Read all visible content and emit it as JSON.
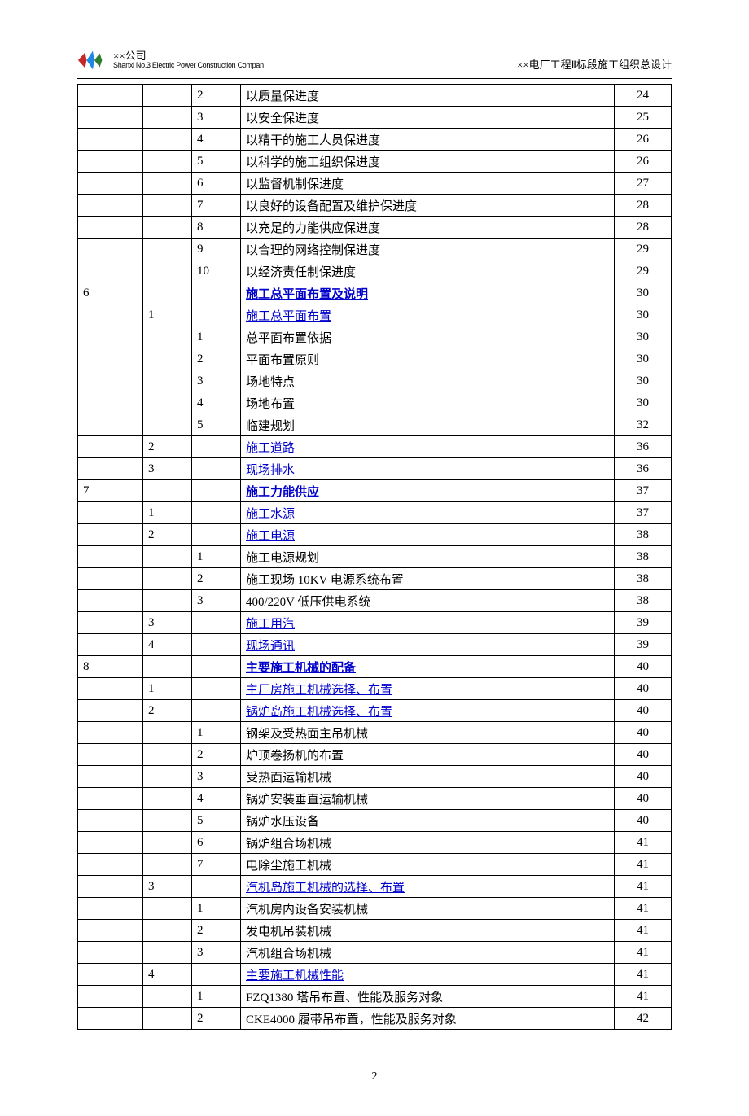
{
  "header": {
    "company_cn": "××公司",
    "company_en": "Shanxi No.3 Electric Power Construction Compan",
    "doc_title": "××电厂工程Ⅱ标段施工组织总设计"
  },
  "rows": [
    {
      "c1": "",
      "c2": "",
      "c3": "2",
      "title": "以质量保进度",
      "type": "plain",
      "page": "24"
    },
    {
      "c1": "",
      "c2": "",
      "c3": "3",
      "title": "以安全保进度",
      "type": "plain",
      "page": "25"
    },
    {
      "c1": "",
      "c2": "",
      "c3": "4",
      "title": "以精干的施工人员保进度",
      "type": "plain",
      "page": "26"
    },
    {
      "c1": "",
      "c2": "",
      "c3": "5",
      "title": "以科学的施工组织保进度",
      "type": "plain",
      "page": "26"
    },
    {
      "c1": "",
      "c2": "",
      "c3": "6",
      "title": "以监督机制保进度",
      "type": "plain",
      "page": "27"
    },
    {
      "c1": "",
      "c2": "",
      "c3": "7",
      "title": "以良好的设备配置及维护保进度",
      "type": "plain",
      "page": "28"
    },
    {
      "c1": "",
      "c2": "",
      "c3": "8",
      "title": "以充足的力能供应保进度",
      "type": "plain",
      "page": "28"
    },
    {
      "c1": "",
      "c2": "",
      "c3": "9",
      "title": "以合理的网络控制保进度",
      "type": "plain",
      "page": "29"
    },
    {
      "c1": "",
      "c2": "",
      "c3": "10",
      "title": "以经济责任制保进度",
      "type": "plain",
      "page": "29"
    },
    {
      "c1": "6",
      "c2": "",
      "c3": "",
      "title": "施工总平面布置及说明",
      "type": "l1",
      "page": "30"
    },
    {
      "c1": "",
      "c2": "1",
      "c3": "",
      "title": "施工总平面布置",
      "type": "l2",
      "page": "30"
    },
    {
      "c1": "",
      "c2": "",
      "c3": "1",
      "title": "总平面布置依据",
      "type": "plain",
      "page": "30"
    },
    {
      "c1": "",
      "c2": "",
      "c3": "2",
      "title": "平面布置原则",
      "type": "plain",
      "page": "30"
    },
    {
      "c1": "",
      "c2": "",
      "c3": "3",
      "title": "场地特点",
      "type": "plain",
      "page": "30"
    },
    {
      "c1": "",
      "c2": "",
      "c3": "4",
      "title": "场地布置",
      "type": "plain",
      "page": "30"
    },
    {
      "c1": "",
      "c2": "",
      "c3": "5",
      "title": "临建规划",
      "type": "plain",
      "page": "32"
    },
    {
      "c1": "",
      "c2": "2",
      "c3": "",
      "title": "施工道路",
      "type": "l2",
      "page": "36"
    },
    {
      "c1": "",
      "c2": "3",
      "c3": "",
      "title": "现场排水",
      "type": "l2",
      "page": "36"
    },
    {
      "c1": "7",
      "c2": "",
      "c3": "",
      "title": "施工力能供应",
      "type": "l1",
      "page": "37"
    },
    {
      "c1": "",
      "c2": "1",
      "c3": "",
      "title": "施工水源",
      "type": "l2",
      "page": "37"
    },
    {
      "c1": "",
      "c2": "2",
      "c3": "",
      "title": "施工电源",
      "type": "l2",
      "page": "38"
    },
    {
      "c1": "",
      "c2": "",
      "c3": "1",
      "title": "施工电源规划",
      "type": "plain",
      "page": "38"
    },
    {
      "c1": "",
      "c2": "",
      "c3": "2",
      "title": "施工现场 10KV 电源系统布置",
      "type": "plain",
      "page": "38"
    },
    {
      "c1": "",
      "c2": "",
      "c3": "3",
      "title": "400/220V 低压供电系统",
      "type": "plain",
      "page": "38"
    },
    {
      "c1": "",
      "c2": "3",
      "c3": "",
      "title": "施工用汽",
      "type": "l2",
      "page": "39"
    },
    {
      "c1": "",
      "c2": "4",
      "c3": "",
      "title": "现场通讯",
      "type": "l2",
      "page": "39"
    },
    {
      "c1": "8",
      "c2": "",
      "c3": "",
      "title": "主要施工机械的配备",
      "type": "l1",
      "page": "40"
    },
    {
      "c1": "",
      "c2": "1",
      "c3": "",
      "title": "主厂房施工机械选择、布置",
      "type": "l2",
      "page": "40"
    },
    {
      "c1": "",
      "c2": "2",
      "c3": "",
      "title": "锅炉岛施工机械选择、布置",
      "type": "l2",
      "page": "40"
    },
    {
      "c1": "",
      "c2": "",
      "c3": "1",
      "title": "钢架及受热面主吊机械",
      "type": "plain",
      "page": "40"
    },
    {
      "c1": "",
      "c2": "",
      "c3": "2",
      "title": "炉顶卷扬机的布置",
      "type": "plain",
      "page": "40"
    },
    {
      "c1": "",
      "c2": "",
      "c3": "3",
      "title": "受热面运输机械",
      "type": "plain",
      "page": "40"
    },
    {
      "c1": "",
      "c2": "",
      "c3": "4",
      "title": "锅炉安装垂直运输机械",
      "type": "plain",
      "page": "40"
    },
    {
      "c1": "",
      "c2": "",
      "c3": "5",
      "title": "锅炉水压设备",
      "type": "plain",
      "page": "40"
    },
    {
      "c1": "",
      "c2": "",
      "c3": "6",
      "title": "锅炉组合场机械",
      "type": "plain",
      "page": "41"
    },
    {
      "c1": "",
      "c2": "",
      "c3": "7",
      "title": "电除尘施工机械",
      "type": "plain",
      "page": "41"
    },
    {
      "c1": "",
      "c2": "3",
      "c3": "",
      "title": "汽机岛施工机械的选择、布置",
      "type": "l2",
      "page": "41"
    },
    {
      "c1": "",
      "c2": "",
      "c3": "1",
      "title": "汽机房内设备安装机械",
      "type": "plain",
      "page": "41"
    },
    {
      "c1": "",
      "c2": "",
      "c3": "2",
      "title": "发电机吊装机械",
      "type": "plain",
      "page": "41"
    },
    {
      "c1": "",
      "c2": "",
      "c3": "3",
      "title": "汽机组合场机械",
      "type": "plain",
      "page": "41"
    },
    {
      "c1": "",
      "c2": "4",
      "c3": "",
      "title": "主要施工机械性能",
      "type": "l2",
      "page": "41"
    },
    {
      "c1": "",
      "c2": "",
      "c3": "1",
      "title": "FZQ1380 塔吊布置、性能及服务对象",
      "type": "plain",
      "page": "41"
    },
    {
      "c1": "",
      "c2": "",
      "c3": "2",
      "title": "CKE4000 履带吊布置，性能及服务对象",
      "type": "plain",
      "page": "42"
    }
  ],
  "footer_page": "2"
}
